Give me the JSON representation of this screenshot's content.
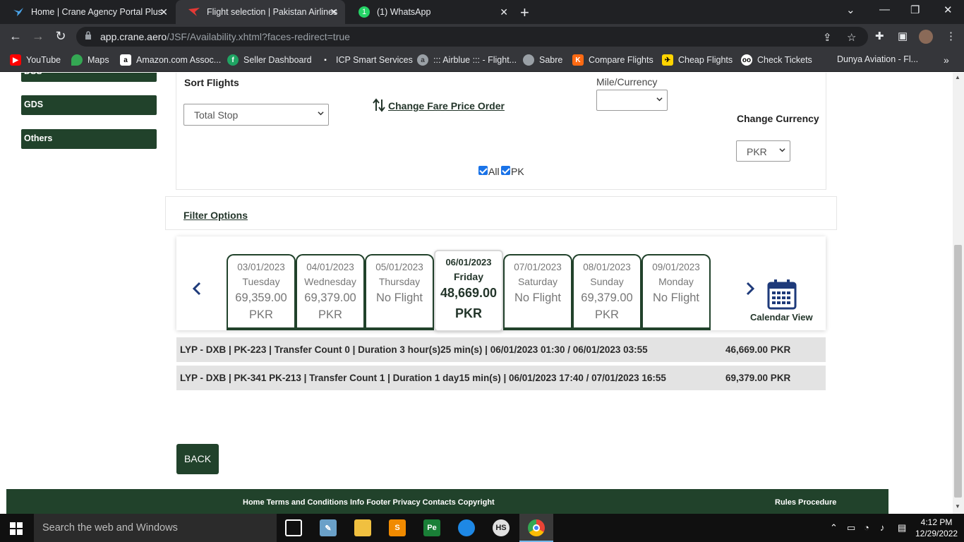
{
  "browser": {
    "tabs": [
      {
        "label": "Home | Crane Agency Portal Plus",
        "active": false
      },
      {
        "label": "Flight selection | Pakistan Airlines",
        "active": true
      },
      {
        "label": "(1) WhatsApp",
        "active": false
      }
    ],
    "url_domain": "app.crane.aero",
    "url_path": "/JSF/Availability.xhtml?faces-redirect=true",
    "bookmarks": [
      "YouTube",
      "Maps",
      "Amazon.com Assoc...",
      "Seller Dashboard",
      "ICP Smart Services",
      "::: Airblue ::: - Flight...",
      "Sabre",
      "Compare Flights",
      "Cheap Flights",
      "Check Tickets",
      "Dunya Aviation - Fl..."
    ]
  },
  "sidebar": {
    "items": [
      {
        "label": "DSS"
      },
      {
        "label": "GDS"
      },
      {
        "label": "Others"
      }
    ]
  },
  "sort": {
    "title": "Sort Flights",
    "sort_value": "Total Stop",
    "change_order_label": "Change Fare Price Order",
    "mile_currency_label": "Mile/Currency",
    "mile_currency_value": "",
    "change_currency_label": "Change Currency",
    "currency_value": "PKR",
    "checkbox_all": "All",
    "checkbox_pk": "PK"
  },
  "filter": {
    "label": "Filter Options"
  },
  "dates": [
    {
      "date": "03/01/2023",
      "weekday": "Tuesday",
      "price": "69,359.00",
      "currency": "PKR"
    },
    {
      "date": "04/01/2023",
      "weekday": "Wednesday",
      "price": "69,379.00",
      "currency": "PKR"
    },
    {
      "date": "05/01/2023",
      "weekday": "Thursday",
      "price": "No Flight",
      "currency": ""
    },
    {
      "date": "06/01/2023",
      "weekday": "Friday",
      "price": "48,669.00",
      "currency": "PKR"
    },
    {
      "date": "07/01/2023",
      "weekday": "Saturday",
      "price": "No Flight",
      "currency": ""
    },
    {
      "date": "08/01/2023",
      "weekday": "Sunday",
      "price": "69,379.00",
      "currency": "PKR"
    },
    {
      "date": "09/01/2023",
      "weekday": "Monday",
      "price": "No Flight",
      "currency": ""
    }
  ],
  "calendar_view_label": "Calendar View",
  "flights": [
    {
      "info": "LYP - DXB | PK-223 | Transfer Count 0 | Duration 3 hour(s)25 min(s) | 06/01/2023 01:30 / 06/01/2023 03:55",
      "price": "46,669.00 PKR"
    },
    {
      "info": "LYP - DXB | PK-341 PK-213 | Transfer Count 1 | Duration 1 day15 min(s) | 06/01/2023 17:40 / 07/01/2023 16:55",
      "price": "69,379.00 PKR"
    }
  ],
  "back_label": "BACK",
  "footer": {
    "links": "Home Terms and Conditions Info Footer Privacy Contacts Copyright",
    "rules": "Rules Procedure"
  },
  "taskbar": {
    "search_placeholder": "Search the web and Windows",
    "time": "4:12 PM",
    "date": "12/29/2022"
  },
  "colors": {
    "brand_green": "#21422b",
    "tab_bar": "#202124",
    "toolbar": "#35363a"
  }
}
